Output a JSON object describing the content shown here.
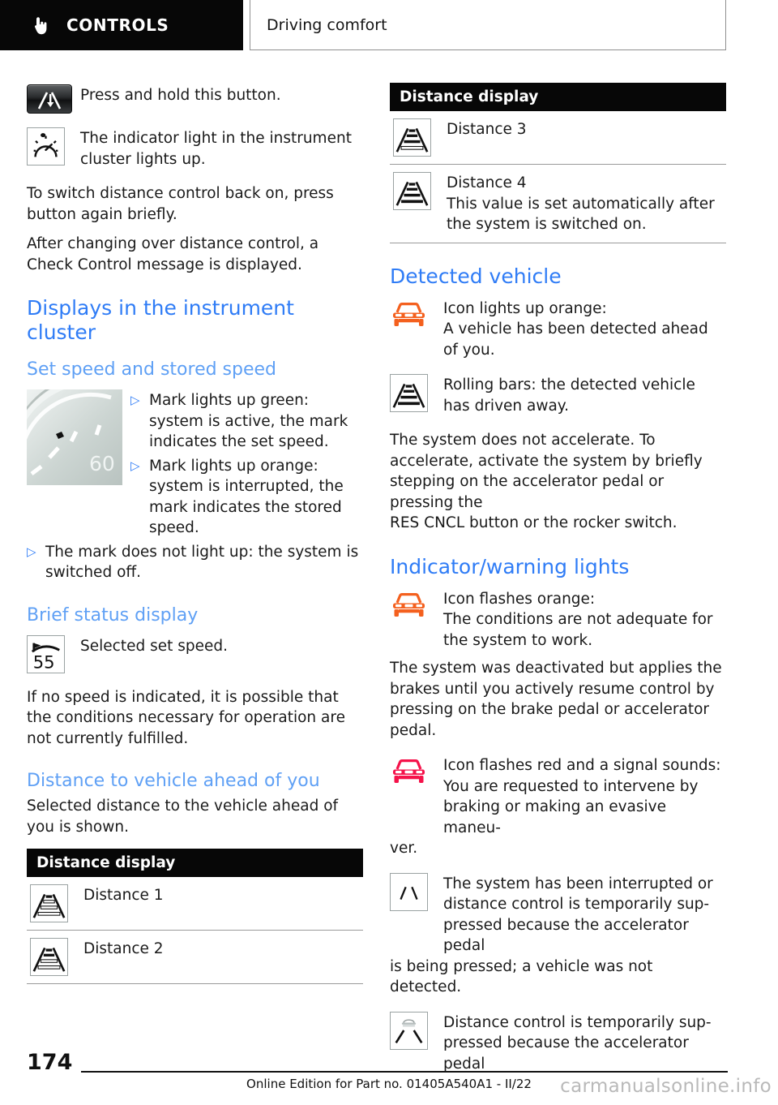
{
  "header": {
    "tab_label": "CONTROLS",
    "tab_icon": "hand-pointer-icon",
    "breadcrumb": "Driving comfort"
  },
  "colors": {
    "heading_main": "#2f7cf6",
    "heading_sub": "#5fa0f5",
    "bullet": "#2f7cf6",
    "icon_orange": "#f4601e",
    "icon_red": "#f5124a",
    "table_header_bg": "#070707"
  },
  "left": {
    "row_button": {
      "icon": "distance-control-button-icon",
      "text": "Press and hold this button."
    },
    "row_indicator": {
      "icon": "speedometer-indicator-icon",
      "text": "The indicator light in the instrument cluster lights up."
    },
    "para_1": "To switch distance control back on, press button again briefly.",
    "para_2": "After changing over distance control, a Check Control message is displayed.",
    "heading_1": "Displays in the instrument cluster",
    "subheading_1": "Set speed and stored speed",
    "gauge": {
      "icon": "instrument-cluster-gauge-image",
      "speed_label": "60"
    },
    "bullets_gauge": [
      "Mark lights up green: system is active, the mark indicates the set speed.",
      "Mark lights up orange: system is interrupted, the mark indicates the stored speed."
    ],
    "bullet_full": "The mark does not light up: the system is switched off.",
    "subheading_2": "Brief status display",
    "row_setspeed": {
      "icon": "set-speed-55-icon",
      "value": "55",
      "text": "Selected set speed."
    },
    "para_3": "If no speed is indicated, it is possible that the conditions necessary for operation are not currently fulfilled.",
    "subheading_3": "Distance to vehicle ahead of you",
    "para_4": "Selected distance to the vehicle ahead of you is shown.",
    "table": {
      "header": "Distance display",
      "rows": [
        {
          "icon": "distance-1-icon",
          "bars": 1,
          "label": "Distance 1",
          "note": ""
        },
        {
          "icon": "distance-2-icon",
          "bars": 2,
          "label": "Distance 2",
          "note": ""
        }
      ]
    }
  },
  "right": {
    "table": {
      "header": "Distance display",
      "rows": [
        {
          "icon": "distance-3-icon",
          "bars": 3,
          "label": "Distance 3",
          "note": ""
        },
        {
          "icon": "distance-4-icon",
          "bars": 4,
          "label": "Distance 4",
          "note": "This value is set automatically after the system is switched on."
        }
      ]
    },
    "heading_detected": "Detected vehicle",
    "row_car_orange": {
      "icon": "car-front-orange-icon",
      "line1": "Icon lights up orange:",
      "line2": "A vehicle has been detected ahead of you."
    },
    "row_rolling_bars": {
      "icon": "rolling-bars-icon",
      "text": "Rolling bars: the detected vehicle has driven away."
    },
    "para_1": "The system does not accelerate. To accelerate, activate the system by briefly stepping on the accelerator pedal or pressing the",
    "para_1b": "RES CNCL button or the rocker switch.",
    "heading_indicator": "Indicator/warning lights",
    "row_car_orange_flash": {
      "icon": "car-front-orange-icon",
      "line1": "Icon flashes orange:",
      "line2": "The conditions are not adequate for the system to work."
    },
    "para_2": "The system was deactivated but applies the brakes until you actively resume control by pressing on the brake pedal or accelerator pedal.",
    "row_car_red": {
      "icon": "car-front-red-icon",
      "line1": "Icon flashes red and a signal sounds:",
      "line2": "You are requested to intervene by braking or making an evasive maneu-"
    },
    "para_3": "ver.",
    "row_lanes": {
      "icon": "lane-markings-icon",
      "text": "The system has been interrupted or distance control is temporarily sup-pressed because the accelerator pedal"
    },
    "para_4": "is being pressed; a vehicle was not detected.",
    "row_lanes_car": {
      "icon": "lane-markings-with-car-icon",
      "text": "Distance control is temporarily sup-pressed because the accelerator pedal"
    }
  },
  "footer": {
    "page_number": "174",
    "edition_text": "Online Edition for Part no. 01405A540A1 - II/22",
    "watermark": "carmanualsonline.info"
  }
}
